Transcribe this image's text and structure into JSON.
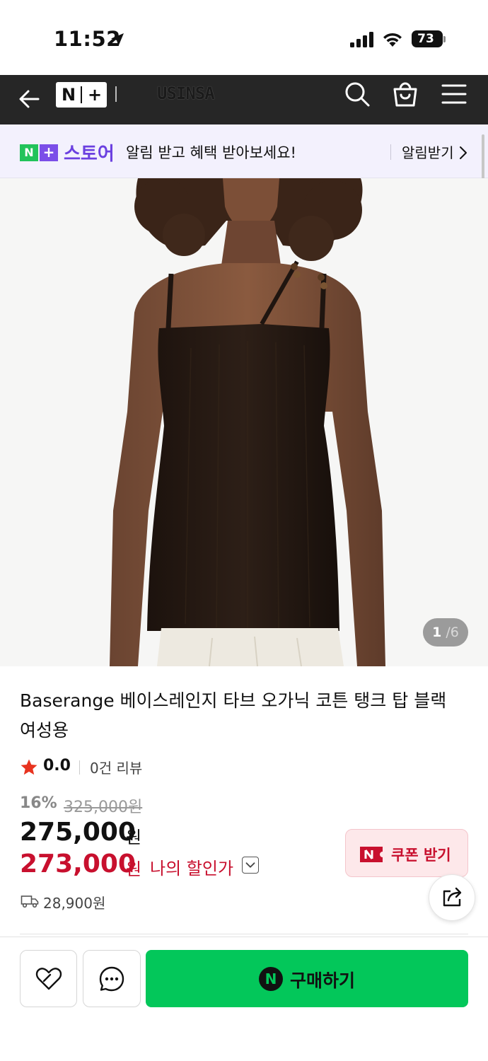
{
  "status_bar": {
    "time": "11:52",
    "battery": "73"
  },
  "nav": {
    "brand": "USINSA",
    "logo_n": "N",
    "logo_plus": "+"
  },
  "store_banner": {
    "logo_n": "N",
    "logo_plus": "+",
    "store_name": "스토어",
    "message": "알림 받고 혜택 받아보세요!",
    "cta": "알림받기"
  },
  "gallery": {
    "current": "1",
    "separator": "/",
    "total": "6"
  },
  "product": {
    "title": "Baserange 베이스레인지 타브 오가닉 코튼 탱크 탑 블랙 여성용",
    "rating": "0.0",
    "review_count": "0건 리뷰",
    "discount_rate": "16%",
    "original_price": "325,000원",
    "sale_price": "275,000",
    "sale_unit": "원",
    "my_price": "273,000",
    "my_unit": "원",
    "my_price_label": "나의 할인가",
    "delivery_fee": "28,900원"
  },
  "coupon": {
    "logo": "N",
    "label": "쿠폰 받기"
  },
  "action_bar": {
    "buy_label": "구매하기",
    "buy_logo": "N"
  },
  "colors": {
    "nav_bg": "#262626",
    "banner_bg": "#f3f1fd",
    "store_purple": "#6b40e0",
    "naver_green": "#03c75a",
    "price_red": "#c8102e"
  }
}
